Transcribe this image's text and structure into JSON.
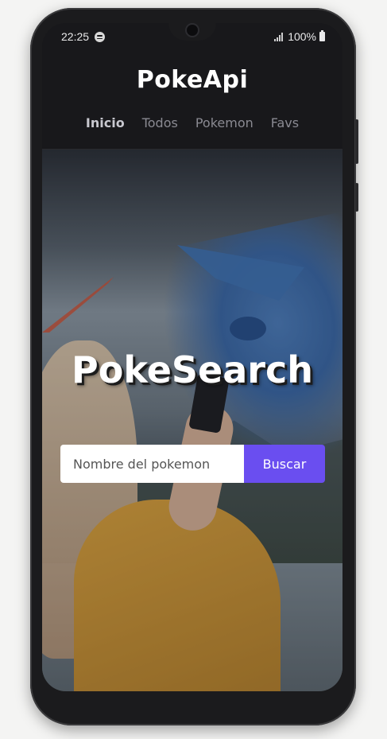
{
  "status_bar": {
    "time": "22:25",
    "battery_percent": "100%",
    "icons": [
      "spotify-icon",
      "signal-icon",
      "battery-icon"
    ]
  },
  "header": {
    "brand": "PokeApi",
    "nav": [
      {
        "label": "Inicio",
        "active": true
      },
      {
        "label": "Todos",
        "active": false
      },
      {
        "label": "Pokemon",
        "active": false
      },
      {
        "label": "Favs",
        "active": false
      }
    ]
  },
  "hero": {
    "title": "PokeSearch",
    "search": {
      "placeholder": "Nombre del pokemon",
      "value": "",
      "button_label": "Buscar"
    }
  },
  "colors": {
    "background": "#18181b",
    "accent": "#6a4ef0",
    "nav_inactive": "#8a8a92",
    "nav_active": "#c8c8cf"
  }
}
